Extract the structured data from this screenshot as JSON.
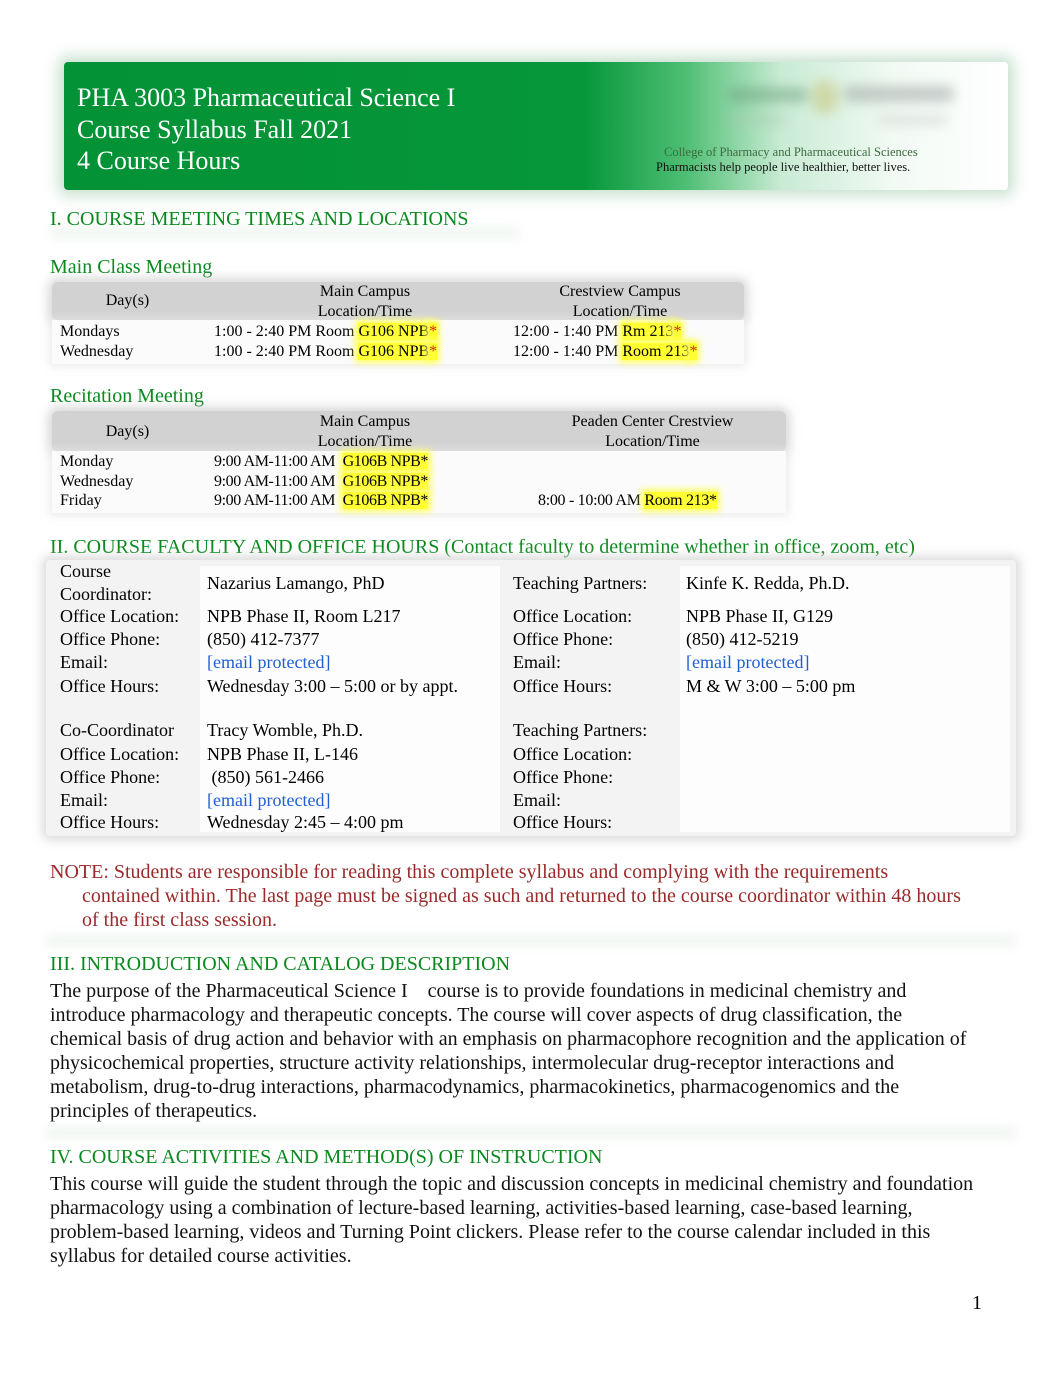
{
  "header": {
    "title_lines": [
      "PHA 3003 Pharmaceutical Science I",
      "Course Syllabus Fall 2021",
      "4 Course Hours"
    ],
    "college_name": "College of Pharmacy and Pharmaceutical Sciences",
    "tagline": "Pharmacists help people live healthier, better lives.",
    "banner_color": "#039235"
  },
  "section1": {
    "heading": "I.  COURSE MEETING TIMES AND LOCATIONS",
    "main_class": {
      "title": "Main Class Meeting",
      "columns": [
        "Day(s)",
        "Main Campus\nLocation/Time",
        "Crestview Campus\nLocation/Time"
      ],
      "col_headers": {
        "day": "Day(s)",
        "main_l1": "Main Campus",
        "main_l2": "Location/Time",
        "other_l1": "Crestview Campus",
        "other_l2": "Location/Time"
      },
      "rows": [
        {
          "day": "Mondays",
          "main_time": "1:00 - 2:40 PM Room ",
          "main_room": "G106 NPB",
          "main_star": "*",
          "other_time": "12:00 - 1:40 PM ",
          "other_room": "Rm 213",
          "other_star": "*"
        },
        {
          "day": "Wednesday",
          "main_time": "1:00 - 2:40 PM Room ",
          "main_room": "G106 NPB",
          "main_star": "*",
          "other_time": "12:00 - 1:40 PM ",
          "other_room": "Room 213",
          "other_star": "*"
        }
      ]
    },
    "recitation": {
      "title": "Recitation Meeting",
      "col_headers": {
        "day": "Day(s)",
        "main_l1": "Main Campus",
        "main_l2": "Location/Time",
        "other_l1": "Peaden Center Crestview",
        "other_l2": "Location/Time"
      },
      "rows": [
        {
          "day": "Monday",
          "main_time": "9:00 AM-11:00 AM ",
          "main_room": "G106B NPB*",
          "other_time": "",
          "other_room": ""
        },
        {
          "day": "Wednesday",
          "main_time": "9:00 AM-11:00 AM ",
          "main_room": "G106B NPB*",
          "other_time": "",
          "other_room": ""
        },
        {
          "day": "Friday",
          "main_time": "9:00 AM-11:00 AM ",
          "main_room": "G106B NPB*",
          "other_time": "8:00 - 10:00 AM ",
          "other_room": "Room 213*"
        }
      ]
    },
    "highlight_color": "#ffff33"
  },
  "section2": {
    "heading": "II.  COURSE FACULTY AND OFFICE HOURS (Contact faculty to determine whether in office, zoom, etc)",
    "blocks": [
      {
        "left": {
          "role_l1": "Course",
          "role_l2": "Coordinator:",
          "name": "Nazarius Lamango, PhD",
          "location_label": "Office Location:",
          "location": "NPB Phase II, Room L217",
          "phone_label": "Office Phone:",
          "phone": "(850) 412-7377",
          "email_label": "Email:",
          "email": "[email protected]",
          "hours_label": "Office Hours:",
          "hours": "Wednesday 3:00 – 5:00 or by appt."
        },
        "right": {
          "role": "Teaching Partners:",
          "name": "Kinfe K. Redda, Ph.D.",
          "location_label": "Office Location:",
          "location": "NPB Phase II, G129",
          "phone_label": "Office Phone:",
          "phone": "(850) 412-5219",
          "email_label": "Email:",
          "email": "[email protected]",
          "hours_label": "Office Hours:",
          "hours": "M & W 3:00 – 5:00 pm"
        }
      },
      {
        "left": {
          "role": "Co-Coordinator",
          "name": "Tracy Womble, Ph.D.",
          "location_label": "Office Location:",
          "location": "NPB Phase II, L-146",
          "phone_label": "Office Phone:",
          "phone": " (850) 561-2466",
          "email_label": "Email:",
          "email": "[email protected]",
          "hours_label": "Office Hours:",
          "hours": "Wednesday 2:45 – 4:00 pm"
        },
        "right": {
          "role": "Teaching Partners:",
          "name": "",
          "location_label": "Office Location:",
          "location": "",
          "phone_label": "Office Phone:",
          "phone": "",
          "email_label": "Email:",
          "email": "",
          "hours_label": "Office Hours:",
          "hours": ""
        }
      }
    ],
    "link_color": "#1f5fd1"
  },
  "note": {
    "line1": "NOTE:  Students are responsible for reading this complete syllabus and complying with the requirements",
    "line2": "contained within. The last page must be signed as such and returned to the course coordinator within 48 hours",
    "line3": "of the first class session.",
    "color": "#9a2a2a"
  },
  "section3": {
    "heading": "III.  INTRODUCTION AND CATALOG DESCRIPTION",
    "lines": [
      "The purpose of the Pharmaceutical Science I    course is to provide foundations in medicinal chemistry and",
      "introduce pharmacology and therapeutic concepts. The course will cover aspects of drug classification, the",
      "chemical basis of drug action and behavior with an emphasis on pharmacophore recognition and the application of",
      "physicochemical properties, structure activity relationships, intermolecular drug-receptor interactions and",
      "metabolism, drug-to-drug interactions, pharmacodynamics, pharmacokinetics, pharmacogenomics and the",
      "principles of therapeutics."
    ]
  },
  "section4": {
    "heading": "IV.  COURSE ACTIVITIES AND METHOD(S) OF INSTRUCTION",
    "lines": [
      "This course will guide the student through the topic and discussion concepts in medicinal chemistry and foundation",
      "pharmacology using a combination of lecture-based learning, activities-based learning, case-based learning,",
      "problem-based learning, videos and Turning Point clickers. Please refer to the course calendar included in this",
      "syllabus for detailed course activities."
    ]
  },
  "footer": {
    "page_number": "1"
  }
}
